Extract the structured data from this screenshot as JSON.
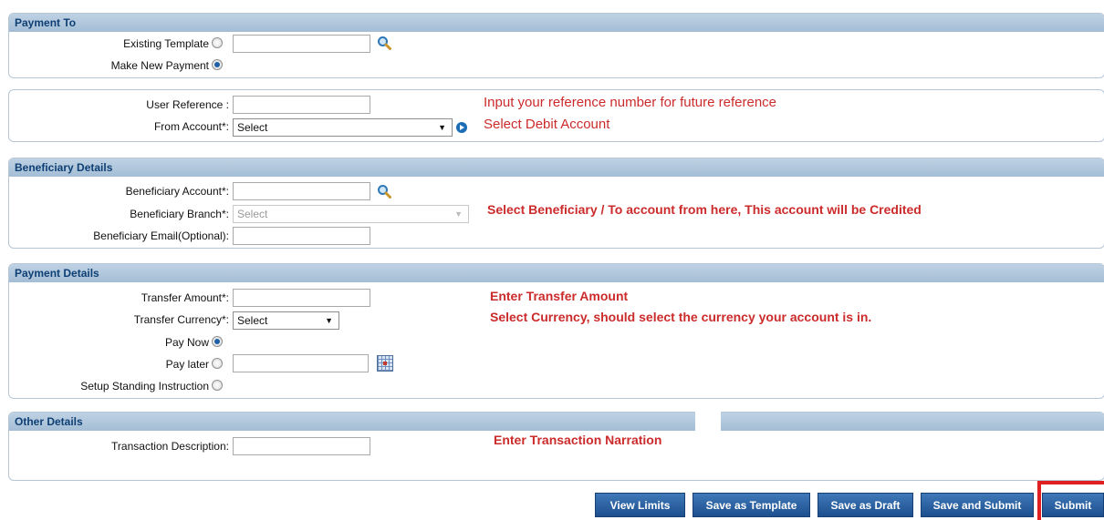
{
  "payment_to": {
    "header": "Payment To",
    "existing_template_label": "Existing Template",
    "make_new_payment_label": "Make New Payment",
    "existing_template_value": ""
  },
  "reference": {
    "user_reference_label": "User Reference :",
    "from_account_label": "From Account*:",
    "from_account_value": "Select",
    "note_reference": "Input your reference number for future reference",
    "note_debit": "Select Debit Account"
  },
  "beneficiary": {
    "header": "Beneficiary Details",
    "account_label": "Beneficiary Account*:",
    "branch_label": "Beneficiary Branch*:",
    "branch_value": "Select",
    "email_label": "Beneficiary Email(Optional):",
    "note": "Select Beneficiary / To account from here, This account will be Credited"
  },
  "payment_details": {
    "header": "Payment Details",
    "amount_label": "Transfer Amount*:",
    "currency_label": "Transfer Currency*:",
    "currency_value": "Select",
    "pay_now_label": "Pay Now",
    "pay_later_label": "Pay later",
    "standing_label": "Setup Standing Instruction",
    "note_amount": "Enter Transfer Amount",
    "note_currency": "Select Currency, should select the currency your account is in."
  },
  "other_details": {
    "header": "Other Details",
    "description_label": "Transaction Description:",
    "note": "Enter Transaction Narration"
  },
  "buttons": {
    "view_limits": "View Limits",
    "save_template": "Save as Template",
    "save_draft": "Save as Draft",
    "save_submit": "Save and Submit",
    "submit": "Submit"
  },
  "colors": {
    "accent": "#1d4f8e",
    "note": "#cc2b2b",
    "highlight": "#e02020"
  }
}
